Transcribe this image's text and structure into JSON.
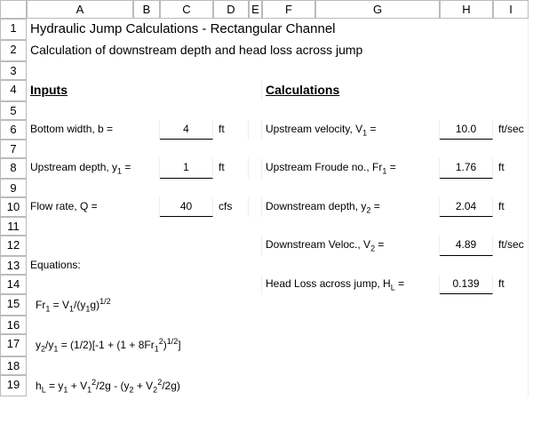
{
  "columns": [
    "A",
    "B",
    "C",
    "D",
    "E",
    "F",
    "G",
    "H",
    "I"
  ],
  "rows": [
    "1",
    "2",
    "3",
    "4",
    "5",
    "6",
    "7",
    "8",
    "9",
    "10",
    "11",
    "12",
    "13",
    "14",
    "15",
    "16",
    "17",
    "18",
    "19"
  ],
  "title1": "Hydraulic Jump Calculations - Rectangular Channel",
  "title2": "Calculation of downstream depth and head loss across jump",
  "inputs_header": "Inputs",
  "calcs_header": "Calculations",
  "inputs": {
    "bottom_width": {
      "label": "Bottom width, b =",
      "value": "4",
      "unit": "ft"
    },
    "upstream_depth": {
      "label_pre": "Upstream depth, y",
      "label_sub": "1",
      "label_post": " =",
      "value": "1",
      "unit": "ft"
    },
    "flow_rate": {
      "label": "Flow rate, Q =",
      "value": "40",
      "unit": "cfs"
    }
  },
  "calcs": {
    "upstream_velocity": {
      "label_pre": "Upstream velocity, V",
      "label_sub": "1",
      "label_post": " =",
      "value": "10.0",
      "unit": "ft/sec"
    },
    "upstream_froude": {
      "label_pre": "Upstream Froude no., Fr",
      "label_sub": "1",
      "label_post": " =",
      "value": "1.76",
      "unit": "ft"
    },
    "downstream_depth": {
      "label_pre": "Downstream depth, y",
      "label_sub": "2",
      "label_post": " =",
      "value": "2.04",
      "unit": "ft"
    },
    "downstream_velocity": {
      "label_pre": "Downstream Veloc., V",
      "label_sub": "2",
      "label_post": " =",
      "value": "4.89",
      "unit": "ft/sec"
    },
    "head_loss": {
      "label_pre": "Head Loss across jump, H",
      "label_sub": "L",
      "label_post": " =",
      "value": "0.139",
      "unit": "ft"
    }
  },
  "equations_header": "Equations:",
  "eq1": {
    "pre": "Fr",
    "s1": "1",
    "mid": " = V",
    "s2": "1",
    "mid2": "/(y",
    "s3": "1",
    "mid3": "g)",
    "sup": "1/2"
  },
  "eq2": {
    "pre": "y",
    "s1": "2",
    "mid": "/y",
    "s2": "1",
    "mid2": " = (1/2)[-1 + (1 + 8Fr",
    "s3": "1",
    "sup1": "2",
    "mid3": ")",
    "sup2": "1/2",
    "post": "]"
  },
  "eq3": {
    "pre": "h",
    "s1": "L",
    "mid": " = y",
    "s2": "1",
    "mid2": " + V",
    "s3": "1",
    "sup1": "2",
    "mid3": "/2g - (y",
    "s4": "2",
    "mid4": " + V",
    "s5": "2",
    "sup2": "2",
    "post": "/2g)"
  }
}
